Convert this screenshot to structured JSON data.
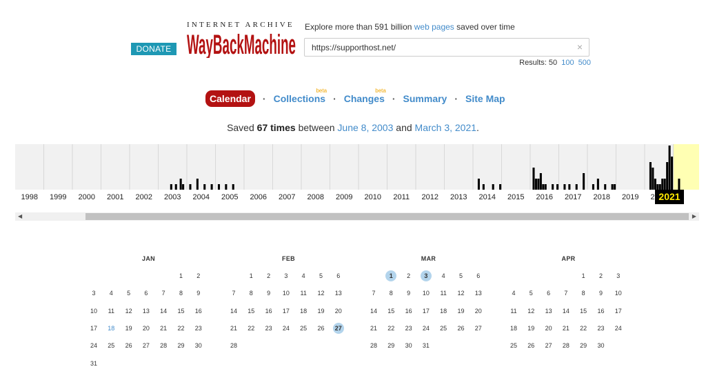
{
  "header": {
    "donate_label": "DONATE",
    "logo_top": "INTERNET ARCHIVE",
    "logo_main": "WayBackMachine",
    "explore_prefix": "Explore more than 591 billion ",
    "explore_link": "web pages",
    "explore_suffix": " saved over time",
    "url_value": "https://supporthost.net/",
    "url_placeholder": "",
    "clear_icon": "×",
    "results_label": "Results: 50",
    "results_100": "100",
    "results_500": "500"
  },
  "tabs": {
    "calendar": "Calendar",
    "collections": "Collections",
    "changes": "Changes",
    "summary": "Summary",
    "sitemap": "Site Map",
    "beta": "beta",
    "separator": "·"
  },
  "saved": {
    "prefix": "Saved ",
    "count": "67 times",
    "middle": " between ",
    "first_date": "June 8, 2003",
    "and": " and ",
    "last_date": "March 3, 2021",
    "end": "."
  },
  "timeline": {
    "years": [
      "1998",
      "1999",
      "2000",
      "2001",
      "2002",
      "2003",
      "2004",
      "2005",
      "2006",
      "2007",
      "2008",
      "2009",
      "2010",
      "2011",
      "2012",
      "2013",
      "2014",
      "2015",
      "2016",
      "2017",
      "2018",
      "2019",
      "2020"
    ],
    "selected_year": "2021",
    "highlight_color": "#ffffb3",
    "bars": [
      {
        "year": 2003,
        "values": [
          0,
          0,
          0,
          0,
          0,
          1,
          0,
          1,
          0,
          2,
          1,
          0
        ]
      },
      {
        "year": 2004,
        "values": [
          0,
          1,
          0,
          0,
          2,
          0,
          0,
          1,
          0,
          0,
          1,
          0
        ]
      },
      {
        "year": 2005,
        "values": [
          0,
          1,
          0,
          0,
          1,
          0,
          0,
          1,
          0,
          0,
          0,
          0
        ]
      },
      {
        "year": 2014,
        "values": [
          0,
          0,
          2,
          0,
          1,
          0,
          0,
          0,
          1,
          0,
          0,
          1
        ]
      },
      {
        "year": 2016,
        "values": [
          0,
          4,
          2,
          2,
          3,
          1,
          1,
          0,
          0,
          1,
          0,
          1
        ]
      },
      {
        "year": 2017,
        "values": [
          0,
          0,
          1,
          0,
          1,
          0,
          0,
          1,
          0,
          0,
          3,
          0
        ]
      },
      {
        "year": 2018,
        "values": [
          0,
          0,
          1,
          0,
          2,
          0,
          0,
          1,
          0,
          0,
          1,
          1
        ]
      },
      {
        "year": 2020,
        "values": [
          0,
          0,
          5,
          4,
          2,
          1,
          1,
          2,
          2,
          5,
          8,
          6
        ]
      },
      {
        "year": 2021,
        "values": [
          0,
          0,
          2,
          0,
          0,
          0,
          0,
          0,
          0,
          0,
          0,
          0
        ]
      }
    ]
  },
  "calendar": {
    "months": [
      {
        "name": "JAN",
        "start": 5,
        "days": 31,
        "captured": [],
        "linked": [
          18
        ]
      },
      {
        "name": "FEB",
        "start": 1,
        "days": 28,
        "captured": [
          27
        ],
        "linked": []
      },
      {
        "name": "MAR",
        "start": 1,
        "days": 31,
        "captured": [
          1,
          3
        ],
        "linked": []
      },
      {
        "name": "APR",
        "start": 4,
        "days": 30,
        "captured": [],
        "linked": []
      }
    ]
  },
  "colors": {
    "accent": "#b31212",
    "link": "#428bca",
    "donate": "#1e98b4",
    "capture": "#b3d4ec"
  }
}
